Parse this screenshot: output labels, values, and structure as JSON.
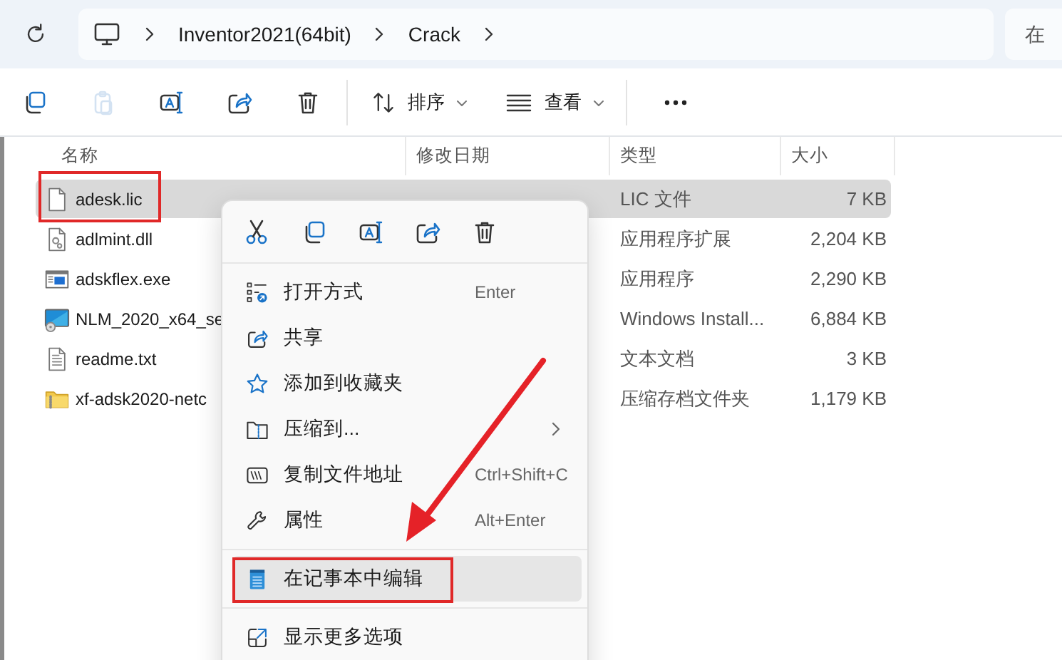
{
  "address_bar": {
    "crumbs": [
      "Inventor2021(64bit)",
      "Crack"
    ]
  },
  "search": {
    "placeholder": "在"
  },
  "toolbar": {
    "buttons": [
      {
        "disabled": false
      },
      {
        "disabled": true
      },
      {
        "disabled": false
      },
      {
        "disabled": false
      },
      {
        "disabled": false
      }
    ],
    "sort": {
      "label": "排序"
    },
    "view": {
      "label": "查看"
    }
  },
  "table": {
    "columns": [
      "名称",
      "修改日期",
      "类型",
      "大小"
    ],
    "rows": [
      {
        "name": "adesk.lic",
        "type": "LIC 文件",
        "size": "7 KB",
        "selected": true,
        "outlined": true
      },
      {
        "name": "adlmint.dll",
        "type": "应用程序扩展",
        "size": "2,204 KB",
        "selected": false,
        "outlined": false
      },
      {
        "name": "adskflex.exe",
        "type": "应用程序",
        "size": "2,290 KB",
        "selected": false,
        "outlined": false
      },
      {
        "name": "NLM_2020_x64_se",
        "type": "Windows Install...",
        "size": "6,884 KB",
        "selected": false,
        "outlined": false
      },
      {
        "name": "readme.txt",
        "type": "文本文档",
        "size": "3 KB",
        "selected": false,
        "outlined": false
      },
      {
        "name": "xf-adsk2020-netc",
        "type": "压缩存档文件夹",
        "size": "1,179 KB",
        "selected": false,
        "outlined": false
      }
    ]
  },
  "context_menu": {
    "sections": [
      [
        {
          "label": "打开方式",
          "shortcut": "Enter",
          "highlighted": false
        },
        {
          "label": "共享",
          "highlighted": false
        },
        {
          "label": "添加到收藏夹",
          "highlighted": false
        },
        {
          "label": "压缩到...",
          "submenu": true,
          "highlighted": false
        },
        {
          "label": "复制文件地址",
          "shortcut": "Ctrl+Shift+C",
          "highlighted": false
        },
        {
          "label": "属性",
          "shortcut": "Alt+Enter",
          "highlighted": false
        }
      ],
      [
        {
          "label": "在记事本中编辑",
          "highlighted": true,
          "outlined": true
        }
      ],
      [
        {
          "label": "显示更多选项",
          "highlighted": false
        }
      ]
    ]
  }
}
